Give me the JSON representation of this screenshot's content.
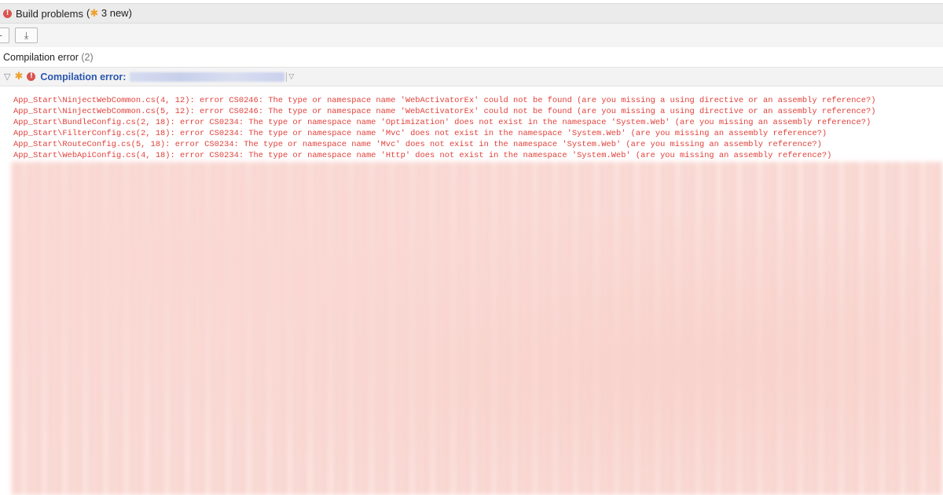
{
  "header": {
    "error_icon": "!",
    "title": "Build problems",
    "new_open": "(",
    "new_star": "✱",
    "new_count": "3 new)"
  },
  "toolbar": {
    "partial_button_icon": "–",
    "download_icon": "⤓"
  },
  "section": {
    "title": "Compilation error",
    "count": "(2)"
  },
  "problem": {
    "expand_icon": "▽",
    "star": "✱",
    "error_icon": "!",
    "label": "Compilation error:",
    "dropdown_icon": "▽"
  },
  "log_lines": [
    "App_Start\\NinjectWebCommon.cs(4, 12): error CS0246: The type or namespace name 'WebActivatorEx' could not be found (are you missing a using directive or an assembly reference?)",
    "App_Start\\NinjectWebCommon.cs(5, 12): error CS0246: The type or namespace name 'WebActivatorEx' could not be found (are you missing a using directive or an assembly reference?)",
    "App_Start\\BundleConfig.cs(2, 18): error CS0234: The type or namespace name 'Optimization' does not exist in the namespace 'System.Web' (are you missing an assembly reference?)",
    "App_Start\\FilterConfig.cs(2, 18): error CS0234: The type or namespace name 'Mvc' does not exist in the namespace 'System.Web' (are you missing an assembly reference?)",
    "App_Start\\RouteConfig.cs(5, 18): error CS0234: The type or namespace name 'Mvc' does not exist in the namespace 'System.Web' (are you missing an assembly reference?)",
    "App_Start\\WebApiConfig.cs(4, 18): error CS0234: The type or namespace name 'Http' does not exist in the namespace 'System.Web' (are you missing an assembly reference?)"
  ],
  "colors": {
    "error_text": "#e0403a",
    "link_blue": "#2a56b0",
    "new_star": "#f0a02a",
    "error_icon": "#d9534f"
  }
}
